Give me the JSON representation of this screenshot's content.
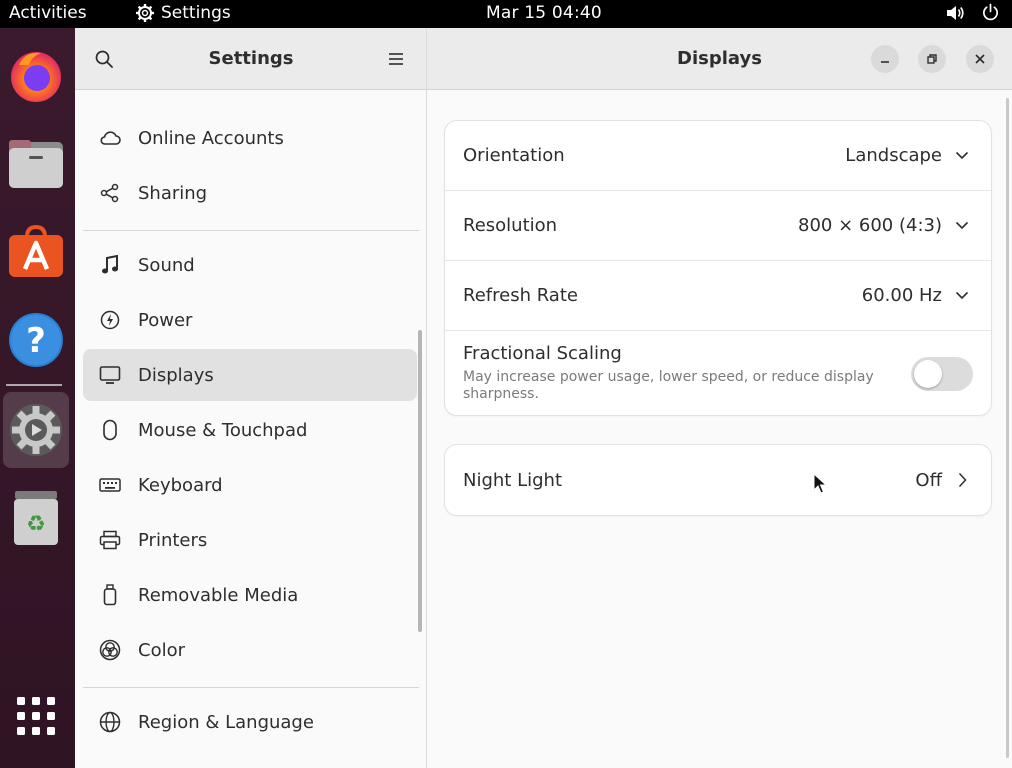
{
  "topbar": {
    "activities": "Activities",
    "app_name": "Settings",
    "clock": "Mar 15  04:40"
  },
  "dock": {
    "items": [
      "firefox-icon",
      "files-icon",
      "app-center-icon",
      "help-icon",
      "settings-icon",
      "trash-icon"
    ],
    "show_apps": "apps-grid-icon"
  },
  "sidebar": {
    "title": "Settings",
    "groups": [
      [
        {
          "label": "Online Accounts",
          "icon": "cloud-icon"
        },
        {
          "label": "Sharing",
          "icon": "share-icon"
        }
      ],
      [
        {
          "label": "Sound",
          "icon": "music-note-icon"
        },
        {
          "label": "Power",
          "icon": "power-icon"
        },
        {
          "label": "Displays",
          "icon": "monitor-icon",
          "selected": true
        },
        {
          "label": "Mouse & Touchpad",
          "icon": "mouse-icon"
        },
        {
          "label": "Keyboard",
          "icon": "keyboard-icon"
        },
        {
          "label": "Printers",
          "icon": "printer-icon"
        },
        {
          "label": "Removable Media",
          "icon": "usb-icon"
        },
        {
          "label": "Color",
          "icon": "color-icon"
        }
      ],
      [
        {
          "label": "Region & Language",
          "icon": "globe-icon"
        }
      ]
    ]
  },
  "content": {
    "title": "Displays",
    "rows": {
      "orientation": {
        "label": "Orientation",
        "value": "Landscape"
      },
      "resolution": {
        "label": "Resolution",
        "value": "800 × 600 (4:3)"
      },
      "refresh_rate": {
        "label": "Refresh Rate",
        "value": "60.00 Hz"
      },
      "fractional_scaling": {
        "label": "Fractional Scaling",
        "description": "May increase power usage, lower speed, or reduce display sharpness.",
        "enabled": false
      },
      "night_light": {
        "label": "Night Light",
        "value": "Off"
      }
    }
  },
  "colors": {
    "accent": "#e95420",
    "dock_bg": "#3a1a2c",
    "header_bg": "#ebebeb",
    "selected_bg": "#e1e1e1"
  }
}
